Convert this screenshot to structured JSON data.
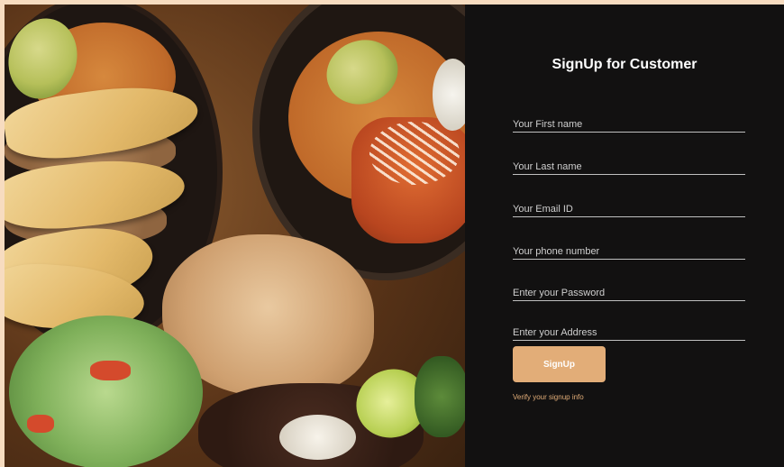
{
  "form": {
    "title": "SignUp for Customer",
    "fields": [
      {
        "placeholder": "Your First name",
        "value": ""
      },
      {
        "placeholder": "Your Last name",
        "value": ""
      },
      {
        "placeholder": "Your Email ID",
        "value": ""
      },
      {
        "placeholder": "Your phone number",
        "value": ""
      },
      {
        "placeholder": "Enter your Password",
        "value": ""
      },
      {
        "placeholder": "Enter your Address",
        "value": ""
      }
    ],
    "signup_label": "SignUp",
    "verify_link": "Verify your signup info"
  },
  "colors": {
    "accent": "#e2ad78",
    "panel_bg": "#121111",
    "page_bg": "#f7dcc0"
  }
}
